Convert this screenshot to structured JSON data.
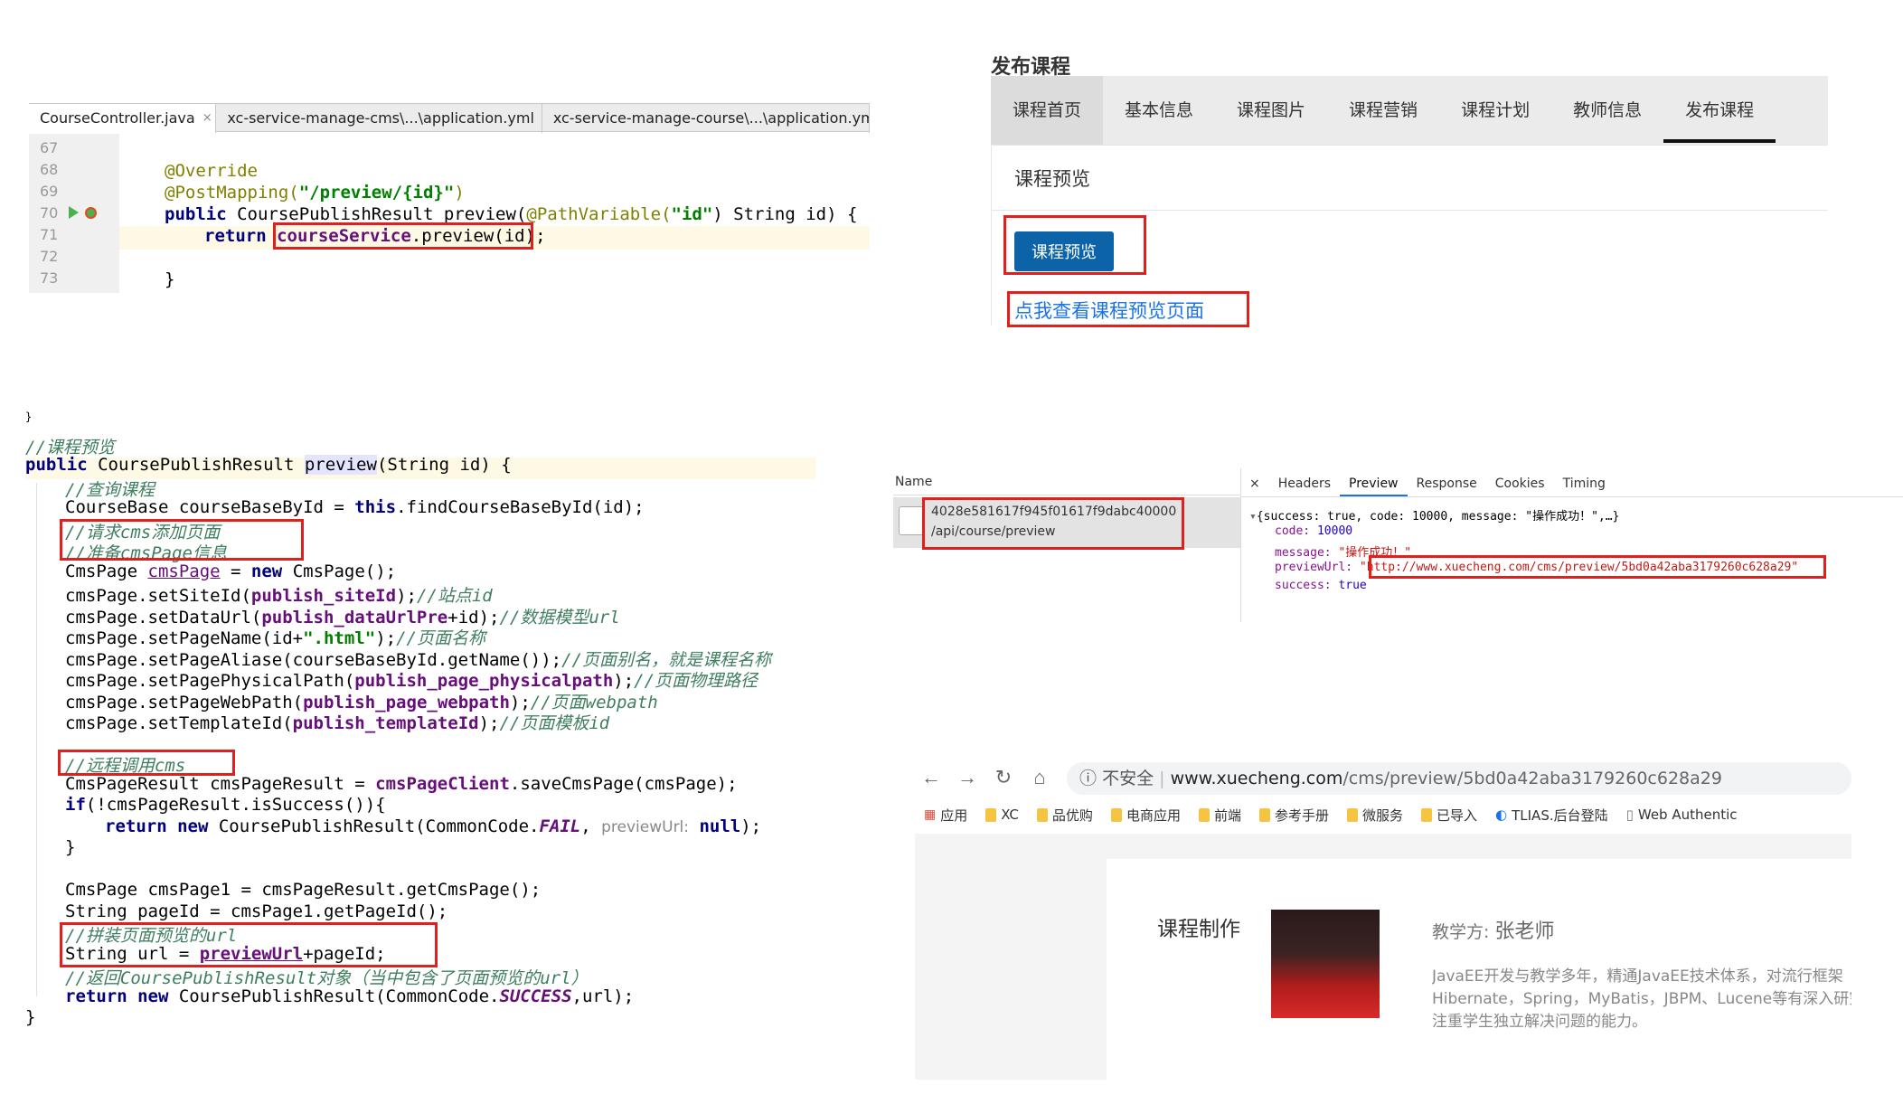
{
  "ide": {
    "tabs": [
      {
        "label": "CourseController.java",
        "active": true
      },
      {
        "label": "xc-service-manage-cms\\...\\application.yml",
        "active": false
      },
      {
        "label": "xc-service-manage-course\\...\\application.yml",
        "active": false
      }
    ],
    "line_numbers": [
      "67",
      "68",
      "69",
      "70",
      "71",
      "72",
      "73"
    ],
    "code": {
      "l68": "@Override",
      "l69a": "@PostMapping(",
      "l69b": "\"/preview/{id}\"",
      "l69c": ")",
      "l70a": "public",
      "l70b": " CoursePublishResult preview(",
      "l70c": "@PathVariable(",
      "l70d": "\"id\"",
      "l70e": ") String id) {",
      "l71a": "return ",
      "l71b": "courseService",
      "l71c": ".preview(id);",
      "l73": "}"
    }
  },
  "publish": {
    "title": "发布课程",
    "tabs": [
      "课程首页",
      "基本信息",
      "课程图片",
      "课程营销",
      "课程计划",
      "教师信息",
      "发布课程"
    ],
    "preview_heading": "课程预览",
    "preview_button": "课程预览",
    "preview_link": "点我查看课程预览页面"
  },
  "code2": {
    "brace_top": "}",
    "comment_preview": "//课程预览",
    "sig_public": "public",
    "sig_rest": " CoursePublishResult ",
    "sig_method": "preview",
    "sig_params": "(String id) {",
    "c_query": "//查询课程",
    "line_find_a": "CourseBase courseBaseById = ",
    "line_find_this": "this",
    "line_find_b": ".findCourseBaseById(id);",
    "c_request": "//请求cms添加页面",
    "c_prepare": "//准备cmsPage信息",
    "line_new_a": "CmsPage ",
    "line_new_var": "cmsPage",
    "line_new_b": " = ",
    "line_new_kw": "new",
    "line_new_c": " CmsPage();",
    "site_a": "cmsPage.setSiteId(",
    "site_f": "publish_siteId",
    "site_b": ");",
    "site_c": "//站点id",
    "data_a": "cmsPage.setDataUrl(",
    "data_f": "publish_dataUrlPre",
    "data_b": "+id);",
    "data_c": "//数据模型url",
    "name_a": "cmsPage.setPageName(id+",
    "name_s": "\".html\"",
    "name_b": ");",
    "name_c": "//页面名称",
    "alias_a": "cmsPage.setPageAliase(courseBaseById.getName());",
    "alias_c": "//页面别名，就是课程名称",
    "phys_a": "cmsPage.setPagePhysicalPath(",
    "phys_f": "publish_page_physicalpath",
    "phys_b": ");",
    "phys_c": "//页面物理路径",
    "web_a": "cmsPage.setPageWebPath(",
    "web_f": "publish_page_webpath",
    "web_b": ");",
    "web_c": "//页面webpath",
    "tpl_a": "cmsPage.setTemplateId(",
    "tpl_f": "publish_templateId",
    "tpl_b": ");",
    "tpl_c": "//页面模板id",
    "c_remote": "//远程调用cms",
    "save_a": "CmsPageResult cmsPageResult = ",
    "save_f": "cmsPageClient",
    "save_b": ".saveCmsPage(cmsPage);",
    "if_kw": "if",
    "if_b": "(!cmsPageResult.isSuccess()){",
    "ret_kw": "return",
    "ret_new": " new",
    "ret_a": " CoursePublishResult(CommonCode.",
    "ret_fail": "FAIL",
    "ret_b": ", ",
    "ret_hint": "previewUrl:",
    "ret_null": " null",
    "ret_c": ");",
    "close_if": "}",
    "page1": "CmsPage cmsPage1 = cmsPageResult.getCmsPage();",
    "pageid": "String pageId = cmsPage1.getPageId();",
    "c_build": "//拼装页面预览的url",
    "url_a": "String url = ",
    "url_f": "previewUrl",
    "url_b": "+pageId;",
    "c_return": "//返回CoursePublishResult对象（当中包含了页面预览的url）",
    "fin_kw": "return",
    "fin_new": " new",
    "fin_a": " CoursePublishResult(CommonCode.",
    "fin_succ": "SUCCESS",
    "fin_b": ",url);",
    "brace_end": "}"
  },
  "devtools": {
    "name_header": "Name",
    "request_id": "4028e581617f945f01617f9dabc40000",
    "request_path": "/api/course/preview",
    "close": "×",
    "tabs": [
      "Headers",
      "Preview",
      "Response",
      "Cookies",
      "Timing"
    ],
    "active_tab": "Preview",
    "summary": "{success: true, code: 10000, message: \"操作成功！\",…}",
    "code_key": "code:",
    "code_val": "10000",
    "message_key": "message:",
    "message_val": "\"操作成功！\"",
    "url_key": "previewUrl:",
    "url_val": "\"http://www.xuecheng.com/cms/preview/5bd0a42aba3179260c628a29\"",
    "success_key": "success:",
    "success_val": "true"
  },
  "browser": {
    "insecure": "不安全",
    "url_host": "www.xuecheng.com",
    "url_path": "/cms/preview/5bd0a42aba3179260c628a29",
    "bookmarks": [
      "应用",
      "XC",
      "品优购",
      "电商应用",
      "前端",
      "参考手册",
      "微服务",
      "已导入",
      "TLIAS.后台登陆",
      "Web Authentic"
    ],
    "course_title": "课程制作",
    "teacher_label": "教学方:",
    "teacher_name": "张老师",
    "teacher_desc": "JavaEE开发与教学多年，精通JavaEE技术体系，对流行框架\nHibernate，Spring，MyBatis，JBPM、Lucene等有深入研究\n注重学生独立解决问题的能力。"
  }
}
